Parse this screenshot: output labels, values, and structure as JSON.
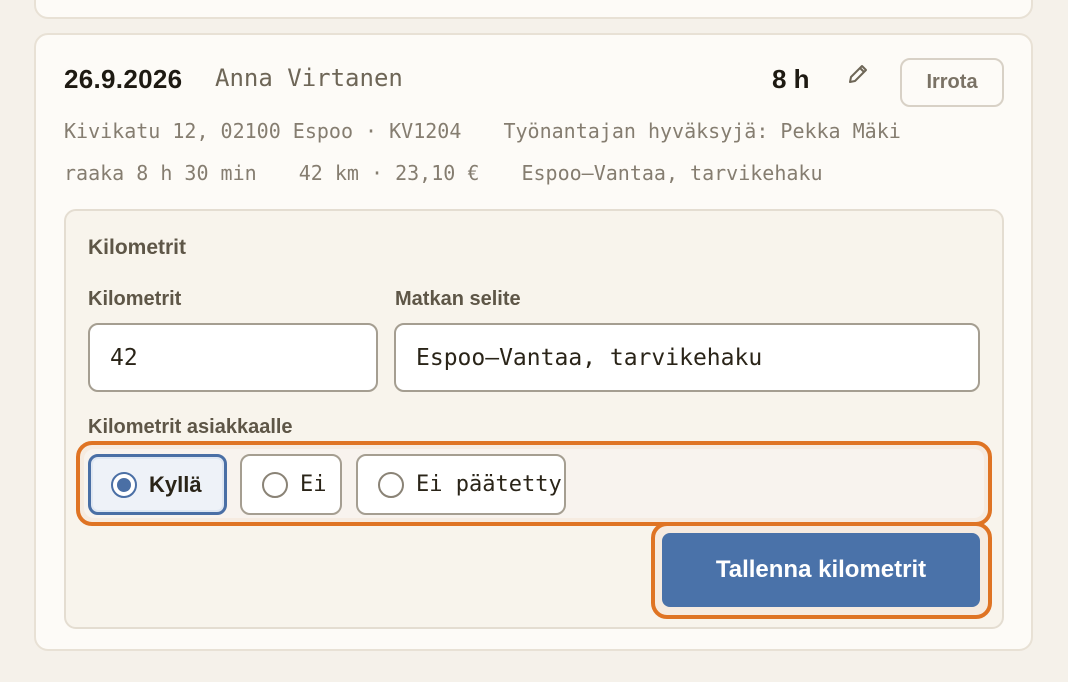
{
  "entry": {
    "date": "26.9.2026",
    "name": "Anna Virtanen",
    "hours": "8 h",
    "edit_icon": "pencil-icon",
    "detach_label": "Irrota",
    "address": "Kivikatu 12, 02100 Espoo · KV1204",
    "approver": "Työnantajan hyväksyjä: Pekka Mäki",
    "raw_time": "raaka 8 h 30 min",
    "km_cost": "42 km · 23,10 €",
    "trip_desc": "Espoo–Vantaa, tarvikehaku"
  },
  "form": {
    "section_title": "Kilometrit",
    "km_label": "Kilometrit",
    "km_value": "42",
    "desc_label": "Matkan selite",
    "desc_value": "Espoo–Vantaa, tarvikehaku",
    "customer_label": "Kilometrit asiakkaalle",
    "options": [
      {
        "label": "Kyllä",
        "selected": true
      },
      {
        "label": "Ei",
        "selected": false
      },
      {
        "label": "Ei päätetty",
        "selected": false
      }
    ],
    "save_label": "Tallenna kilometrit"
  },
  "colors": {
    "accent": "#4a72a9",
    "highlight": "#df7424",
    "background": "#f5f1ea"
  }
}
